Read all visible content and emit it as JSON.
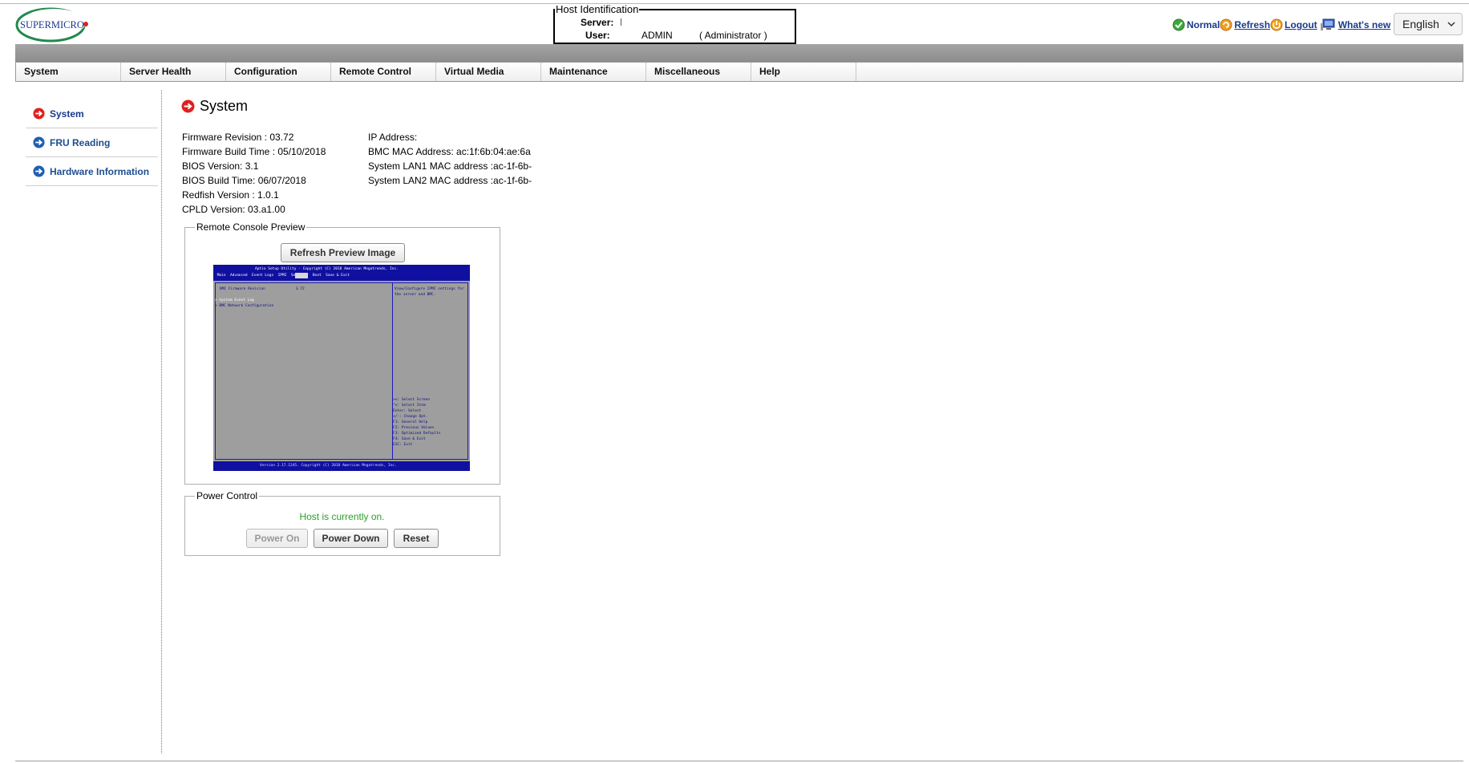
{
  "logo": {
    "text": "SUPERMICRO"
  },
  "host_identification": {
    "legend": "Host Identification",
    "server_label": "Server:",
    "server_value": "",
    "user_label": "User:",
    "user_value": "ADMIN",
    "user_role": "( Administrator )"
  },
  "top_links": {
    "normal": "Normal",
    "refresh": "Refresh",
    "logout": "Logout",
    "whats_new": "What's  new",
    "language": "English"
  },
  "nav": {
    "items": [
      "System",
      "Server Health",
      "Configuration",
      "Remote Control",
      "Virtual Media",
      "Maintenance",
      "Miscellaneous",
      "Help"
    ]
  },
  "sidebar": {
    "items": [
      {
        "label": "System",
        "active": true
      },
      {
        "label": "FRU Reading",
        "active": false
      },
      {
        "label": "Hardware Information",
        "active": false
      }
    ]
  },
  "main": {
    "title": "System",
    "left_info": [
      "Firmware Revision : 03.72",
      "Firmware Build Time : 05/10/2018",
      "BIOS Version: 3.1",
      "BIOS Build Time: 06/07/2018",
      "Redfish Version : 1.0.1",
      "CPLD Version: 03.a1.00"
    ],
    "right_info": [
      "IP Address:",
      "BMC MAC Address: ac:1f:6b:04:ae:6a",
      "System LAN1 MAC address :ac-1f-6b-",
      "System LAN2 MAC address :ac-1f-6b-"
    ]
  },
  "remote_console": {
    "legend": "Remote Console Preview",
    "refresh_button": "Refresh Preview Image",
    "bios_screen": {
      "header_line1": "Aptio Setup Utility - Copyright (C) 2018 American Megatrends, Inc.",
      "header_line2": " Main  Advanced  Event Logs  IPMI  Security  Boot  Save & Exit",
      "left_lines": [
        "BMC Firmware Revision              3.72",
        "",
        "> System Event Log",
        "> BMC Network Configuration"
      ],
      "right_lines": [
        "View/Configure IPMI settings for",
        "the server and BMC."
      ],
      "help_lines": [
        "><: Select Screen",
        "^v: Select Item",
        "Enter: Select",
        "+/-: Change Opt.",
        "F1: General Help",
        "F2: Previous Values",
        "F3: Optimized Defaults",
        "F4: Save & Exit",
        "ESC: Exit"
      ],
      "footer": "Version 2.17.1245. Copyright (C) 2018 American Megatrends, Inc."
    }
  },
  "power_control": {
    "legend": "Power Control",
    "status": "Host is currently on.",
    "power_on": "Power On",
    "power_down": "Power Down",
    "reset": "Reset"
  },
  "colors": {
    "link": "#1a3a8c",
    "status_on": "#2aa02a",
    "active_icon": "#e02020",
    "nav_icon": "#1e5fb4"
  }
}
